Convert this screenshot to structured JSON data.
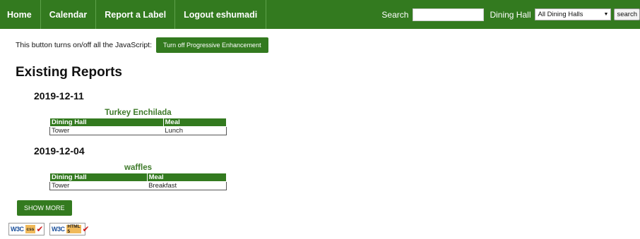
{
  "nav": {
    "items": [
      "Home",
      "Calendar",
      "Report a Label",
      "Logout eshumadi"
    ],
    "search_label": "Search",
    "search_value": "",
    "dining_hall_label": "Dining Hall",
    "dining_hall_selected": "All Dining Halls",
    "search_button": "search"
  },
  "pe": {
    "text": "This button turns on/off all the JavaScript:",
    "button": "Turn off Progressive Enhancement"
  },
  "heading": "Existing Reports",
  "reports": [
    {
      "date": "2019-12-11",
      "food": "Turkey Enchilada",
      "headers": [
        "Dining Hall",
        "Meal"
      ],
      "row": [
        "Tower",
        "Lunch"
      ]
    },
    {
      "date": "2019-12-04",
      "food": "waffles",
      "headers": [
        "Dining Hall",
        "Meal"
      ],
      "row": [
        "Tower",
        "Breakfast"
      ]
    }
  ],
  "show_more": "SHOW MORE",
  "badges": [
    {
      "w3c": "W3C",
      "kind": "css"
    },
    {
      "w3c": "W3C",
      "kind": "HTML 5"
    }
  ],
  "colors": {
    "brand_green": "#337a1f",
    "food_green": "#3e7a2a"
  }
}
